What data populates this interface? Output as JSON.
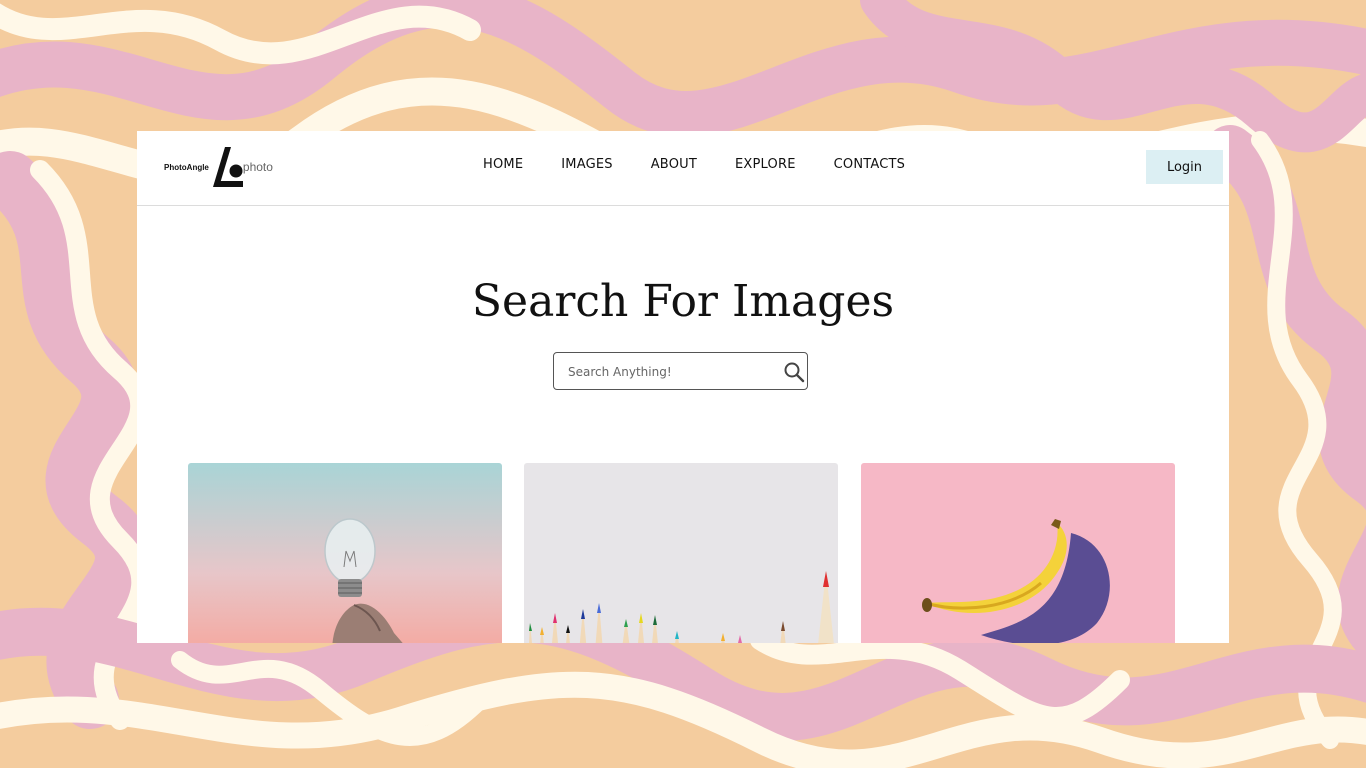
{
  "logo": {
    "left_text": "PhotoAngle",
    "right_text": "photo"
  },
  "nav": {
    "items": [
      {
        "label": "HOME"
      },
      {
        "label": "IMAGES"
      },
      {
        "label": "ABOUT"
      },
      {
        "label": "EXPLORE"
      },
      {
        "label": "CONTACTS"
      }
    ],
    "login_label": "Login"
  },
  "hero": {
    "title": "Search For Images"
  },
  "search": {
    "placeholder": "Search Anything!"
  },
  "gallery": {
    "cards": [
      {
        "subject": "hand holding light bulb"
      },
      {
        "subject": "colored pencils"
      },
      {
        "subject": "banana on pink"
      }
    ]
  },
  "colors": {
    "background_orange": "#f4cc9e",
    "background_pink": "#e8b4c8",
    "background_cream": "#fff8e8",
    "login_bg": "#dceff3"
  },
  "icons": [
    "search-icon",
    "logo-mark-icon"
  ]
}
